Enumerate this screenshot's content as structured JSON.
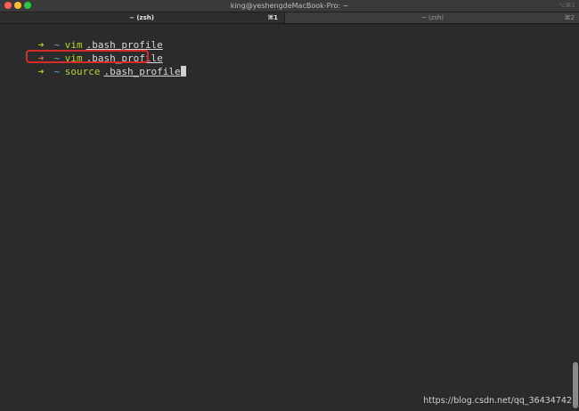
{
  "window": {
    "title": "king@yeshengdeMacBook-Pro: ~",
    "shortcut": "⌥⌘1"
  },
  "tabs": [
    {
      "label": "~ (zsh)",
      "shortcut": "⌘1",
      "active": true
    },
    {
      "label": "~ (zsh)",
      "shortcut": "⌘2",
      "active": false
    }
  ],
  "terminal": {
    "lines": [
      {
        "arrow": "➜",
        "status": "ok",
        "dir": "~",
        "command": "vim",
        "argument": ".bash_profile"
      },
      {
        "arrow": "➜",
        "status": "error",
        "dir": "~",
        "command": "vim",
        "argument": ".bash_profile"
      },
      {
        "arrow": "➜",
        "status": "ok",
        "dir": "~",
        "command": "source",
        "argument": ".bash_profile"
      }
    ]
  },
  "watermark": "https://blog.csdn.net/qq_36434742",
  "colors": {
    "prompt_ok": "#b3d334",
    "prompt_error": "#e0685a",
    "directory": "#52b5c8",
    "highlight_box": "#d62b2b",
    "background": "#2b2b2b"
  }
}
